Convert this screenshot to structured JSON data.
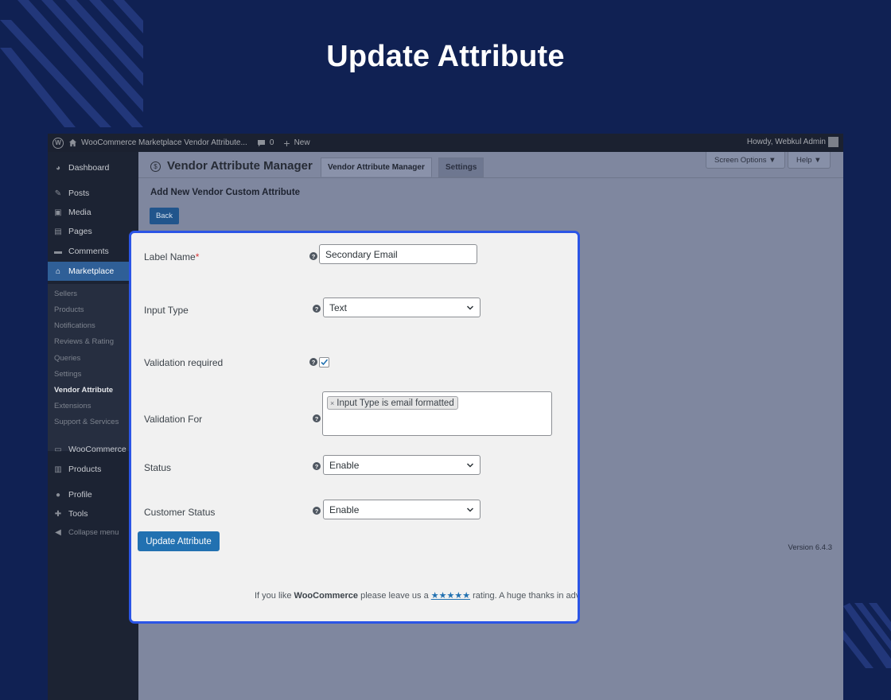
{
  "hero": {
    "title": "Update Attribute"
  },
  "adminbar": {
    "site_name": "WooCommerce Marketplace Vendor Attribute...",
    "comments_count": "0",
    "new_label": "New",
    "howdy": "Howdy, Webkul Admin"
  },
  "sidebar": {
    "dashboard": "Dashboard",
    "posts": "Posts",
    "media": "Media",
    "pages": "Pages",
    "comments": "Comments",
    "marketplace": "Marketplace",
    "submenu": [
      "Sellers",
      "Products",
      "Notifications",
      "Reviews & Rating",
      "Queries",
      "Settings",
      "Vendor Attribute",
      "Extensions",
      "Support & Services"
    ],
    "woocommerce": "WooCommerce",
    "products": "Products",
    "profile": "Profile",
    "tools": "Tools",
    "collapse": "Collapse menu"
  },
  "page": {
    "title": "Vendor Attribute Manager",
    "tabs": [
      "Vendor Attribute Manager",
      "Settings"
    ],
    "screen_options": "Screen Options ▼",
    "help": "Help ▼",
    "subtitle": "Add New Vendor Custom Attribute",
    "back_button": "Back",
    "version": "Version 6.4.3"
  },
  "form": {
    "label_name": {
      "label": "Label Name",
      "required_mark": "*",
      "value": "Secondary Email"
    },
    "input_type": {
      "label": "Input Type",
      "value": "Text"
    },
    "validation_required": {
      "label": "Validation required",
      "checked": true
    },
    "validation_for": {
      "label": "Validation For",
      "token": "Input Type is email formatted",
      "token_remove": "×"
    },
    "status": {
      "label": "Status",
      "value": "Enable"
    },
    "customer_status": {
      "label": "Customer Status",
      "value": "Enable"
    },
    "submit_label": "Update Attribute"
  },
  "footer": {
    "prefix": "If you like ",
    "brand": "WooCommerce",
    "middle": " please leave us a ",
    "stars": "★★★★★",
    "suffix": " rating. A huge thanks in adva"
  },
  "colors": {
    "background": "#102153",
    "highlight_border": "#2b55e6",
    "primary_button": "#2271b1",
    "active_menu": "#2f5f97"
  }
}
